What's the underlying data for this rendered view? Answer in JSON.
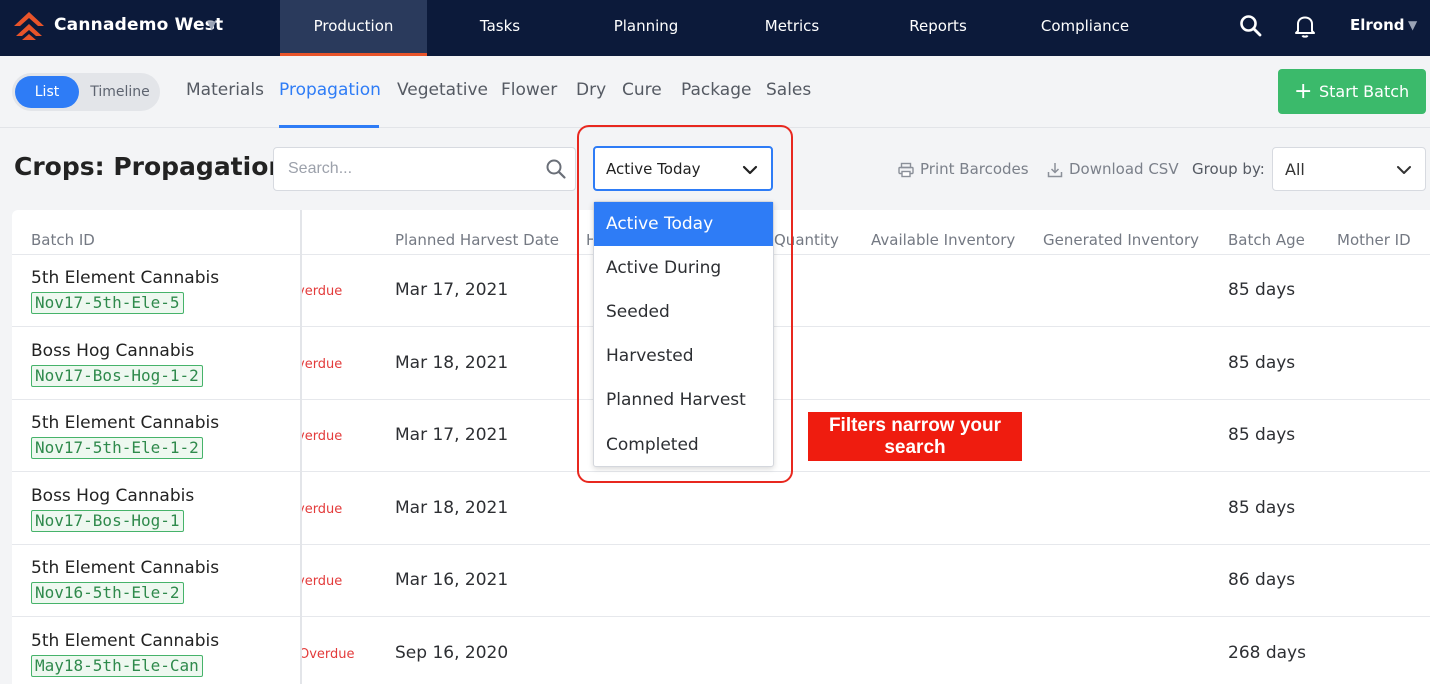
{
  "topbar": {
    "org_name": "Cannademo West",
    "nav": [
      "Production",
      "Tasks",
      "Planning",
      "Metrics",
      "Reports",
      "Compliance"
    ],
    "active_nav": "Production",
    "user_name": "Elrond",
    "icons": [
      "search-icon",
      "bell-icon"
    ]
  },
  "subnav": {
    "view_toggle": [
      "List",
      "Timeline"
    ],
    "active_view": "List",
    "stages": [
      "Materials",
      "Propagation",
      "Vegetative",
      "Flower",
      "Dry",
      "Cure",
      "Package",
      "Sales"
    ],
    "active_stage": "Propagation",
    "start_batch_label": "Start Batch"
  },
  "page": {
    "title": "Crops: Propagation",
    "search_placeholder": "Search...",
    "filter_value": "Active Today",
    "print_barcodes": "Print Barcodes",
    "download_csv": "Download CSV",
    "group_by_label": "Group by:",
    "group_by_value": "All"
  },
  "dropdown": {
    "options": [
      "Active Today",
      "Active During",
      "Seeded",
      "Harvested",
      "Planned Harvest",
      "Completed"
    ],
    "selected": "Active Today"
  },
  "table": {
    "headers": [
      "Batch ID",
      "Planned Harvest Date",
      "H",
      "Quantity",
      "Available Inventory",
      "Generated Inventory",
      "Batch Age",
      "Mother ID"
    ],
    "rows": [
      {
        "strain": "5th Element Cannabis",
        "batch": "Nov17-5th-Ele-5",
        "status": "verdue",
        "harvest": "Mar 17, 2021",
        "age": "85 days"
      },
      {
        "strain": "Boss Hog Cannabis",
        "batch": "Nov17-Bos-Hog-1-2",
        "status": "verdue",
        "harvest": "Mar 18, 2021",
        "age": "85 days"
      },
      {
        "strain": "5th Element Cannabis",
        "batch": "Nov17-5th-Ele-1-2",
        "status": "verdue",
        "harvest": "Mar 17, 2021",
        "age": "85 days"
      },
      {
        "strain": "Boss Hog Cannabis",
        "batch": "Nov17-Bos-Hog-1",
        "status": "verdue",
        "harvest": "Mar 18, 2021",
        "age": "85 days"
      },
      {
        "strain": "5th Element Cannabis",
        "batch": "Nov16-5th-Ele-2",
        "status": "verdue",
        "harvest": "Mar 16, 2021",
        "age": "86 days"
      },
      {
        "strain": "5th Element Cannabis",
        "batch": "May18-5th-Ele-Can",
        "status": "Overdue",
        "harvest": "Sep 16, 2020",
        "age": "268 days"
      }
    ]
  },
  "annotation": {
    "callout_line1": "Filters narrow your",
    "callout_line2": "search",
    "highlight_color": "#e8281f",
    "callout_color": "#ef1c0f"
  },
  "colors": {
    "navbar": "#0c1a3a",
    "accent": "#2e7cf6",
    "brand_orange": "#e8542a",
    "start_button": "#3bba6b",
    "overdue": "#e33b3b"
  }
}
